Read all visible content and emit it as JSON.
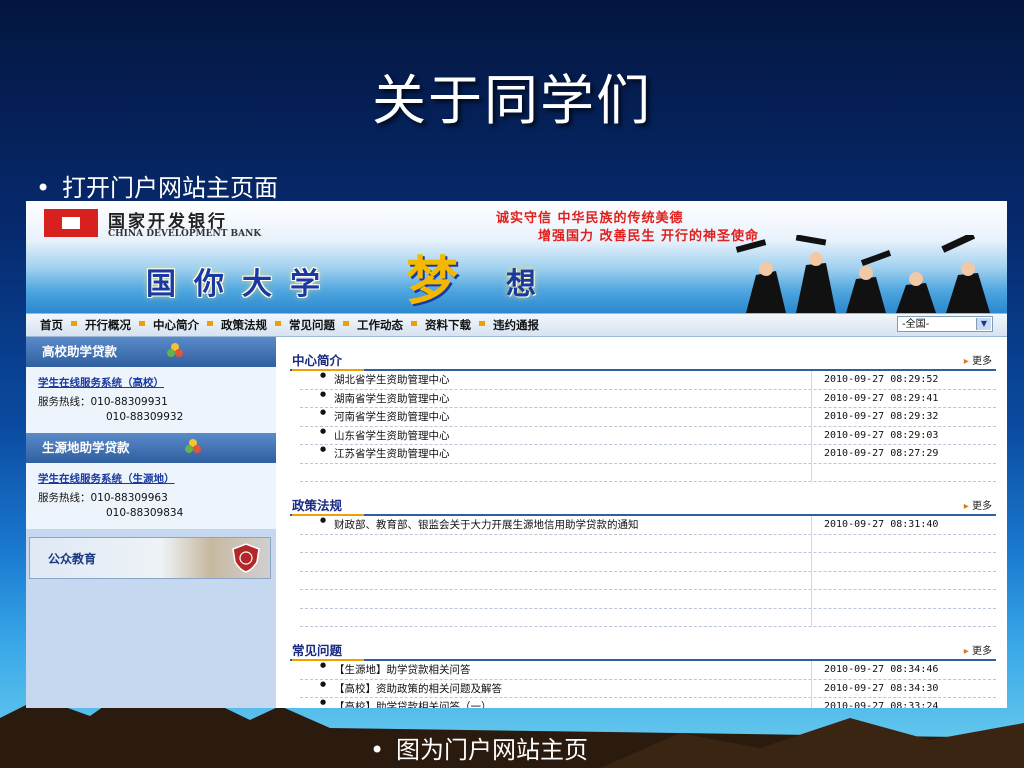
{
  "slide": {
    "title": "关于同学们",
    "bullet_top": "打开门户网站主页面",
    "bullet_bottom": "图为门户网站主页",
    "bullet_glyph": "•"
  },
  "site": {
    "logo_cn": "国家开发银行",
    "logo_en": "CHINA DEVELOPMENT BANK",
    "slogan_line1": "诚实守信  中华民族的传统美德",
    "slogan_line2": "增强国力  改善民生  开行的神圣使命",
    "banner_text_a": "国你大学",
    "banner_text_b": "梦",
    "banner_text_c": "想",
    "nav": [
      "首页",
      "开行概况",
      "中心简介",
      "政策法规",
      "常见问题",
      "工作动态",
      "资料下载",
      "违约通报"
    ],
    "region_select": "-全国-",
    "sidebar": {
      "section1_title": "高校助学贷款",
      "section1_link": "学生在线服务系统（高校）",
      "section1_hotline_label": "服务热线：010-88309931",
      "section1_hotline_2": "010-88309932",
      "section2_title": "生源地助学贷款",
      "section2_link": "学生在线服务系统（生源地）",
      "section2_hotline_label": "服务热线：010-88309963",
      "section2_hotline_2": "010-88309834",
      "edu_label": "公众教育"
    },
    "more_label": "更多",
    "sections": [
      {
        "title": "中心简介",
        "rows": [
          {
            "text": "湖北省学生资助管理中心",
            "date": "2010-09-27 08:29:52"
          },
          {
            "text": "湖南省学生资助管理中心",
            "date": "2010-09-27 08:29:41"
          },
          {
            "text": "河南省学生资助管理中心",
            "date": "2010-09-27 08:29:32"
          },
          {
            "text": "山东省学生资助管理中心",
            "date": "2010-09-27 08:29:03"
          },
          {
            "text": "江苏省学生资助管理中心",
            "date": "2010-09-27 08:27:29"
          }
        ]
      },
      {
        "title": "政策法规",
        "rows": [
          {
            "text": "财政部、教育部、银监会关于大力开展生源地信用助学贷款的通知",
            "date": "2010-09-27 08:31:40"
          }
        ]
      },
      {
        "title": "常见问题",
        "rows": [
          {
            "text": "【生源地】助学贷款相关问答",
            "date": "2010-09-27 08:34:46"
          },
          {
            "text": "【高校】资助政策的相关问题及解答",
            "date": "2010-09-27 08:34:30"
          },
          {
            "text": "【高校】助学贷款相关问答（一）",
            "date": "2010-09-27 08:33:24"
          }
        ]
      }
    ]
  },
  "colors": {
    "accent_orange": "#f0a000",
    "nav_blue": "#2f5f9f",
    "slogan_red": "#e0201e"
  }
}
